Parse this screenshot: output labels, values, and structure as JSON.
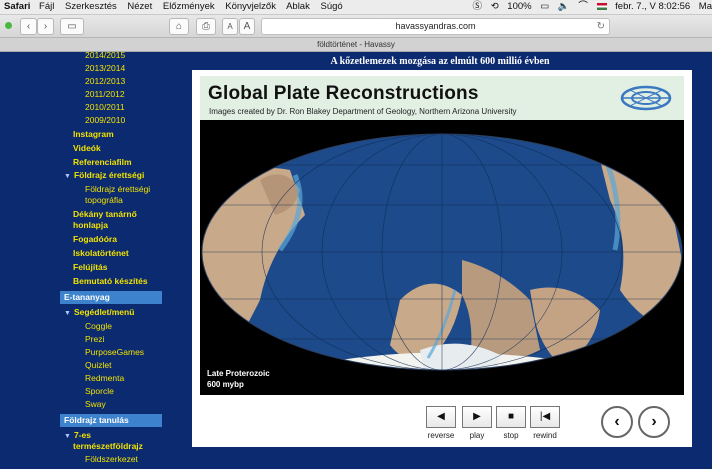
{
  "menubar": {
    "app": "Safari",
    "items": [
      "Fájl",
      "Szerkesztés",
      "Nézet",
      "Előzmények",
      "Könyvjelzők",
      "Ablak",
      "Súgó"
    ],
    "battery": "100%",
    "datetime": "febr. 7., V 8:02:56",
    "user": "Ma"
  },
  "browser": {
    "url": "havassyandras.com",
    "tab_title": "földtörténet - Havassy",
    "font_small": "A",
    "font_large": "A"
  },
  "sidebar": {
    "years": [
      "2014/2015",
      "2013/2014",
      "2012/2013",
      "2011/2012",
      "2010/2011",
      "2009/2010"
    ],
    "links": [
      "Instagram",
      "Videók",
      "Referenciafilm"
    ],
    "section1": "Földrajz érettségi",
    "section1_sub": [
      "Földrajz érettségi",
      "topográfia"
    ],
    "links2": [
      "Dékány tanárnő",
      "honlapja",
      "Fogadóóra",
      "Iskolatörténet",
      "Felújítás",
      "Bemutató készítés"
    ],
    "header_etananyag": "E-tananyag",
    "section2": "Segédlet/menü",
    "section2_sub": [
      "Coggle",
      "Prezi",
      "PurposeGames",
      "Quizlet",
      "Redmenta",
      "Sporcle",
      "Sway"
    ],
    "header_foldrajz": "Földrajz tanulás",
    "section3": [
      "7-es",
      "természetföldrajz"
    ],
    "section3_sub": [
      "Földszerkezet"
    ]
  },
  "main": {
    "page_title": "A kőzetlemezek mozgása az elmúlt 600 millió évben",
    "slide_title": "Global Plate Reconstructions",
    "slide_subtitle": "Images created by Dr. Ron Blakey Department of Geology, Northern Arizona University",
    "map_caption_line1": "Late Proterozoic",
    "map_caption_line2": "600 mybp",
    "controls": [
      {
        "label": "reverse",
        "icon": "◀"
      },
      {
        "label": "play",
        "icon": "▶"
      },
      {
        "label": "stop",
        "icon": "■"
      },
      {
        "label": "rewind",
        "icon": "|◀"
      }
    ],
    "prev_icon": "‹",
    "next_icon": "›"
  },
  "colors": {
    "sidebar_bg": "#0b2a6f",
    "link_yellow": "#f2e200",
    "header_blue": "#3c82cc",
    "ocean": "#1d4a8a",
    "land": "#c8a98a"
  }
}
